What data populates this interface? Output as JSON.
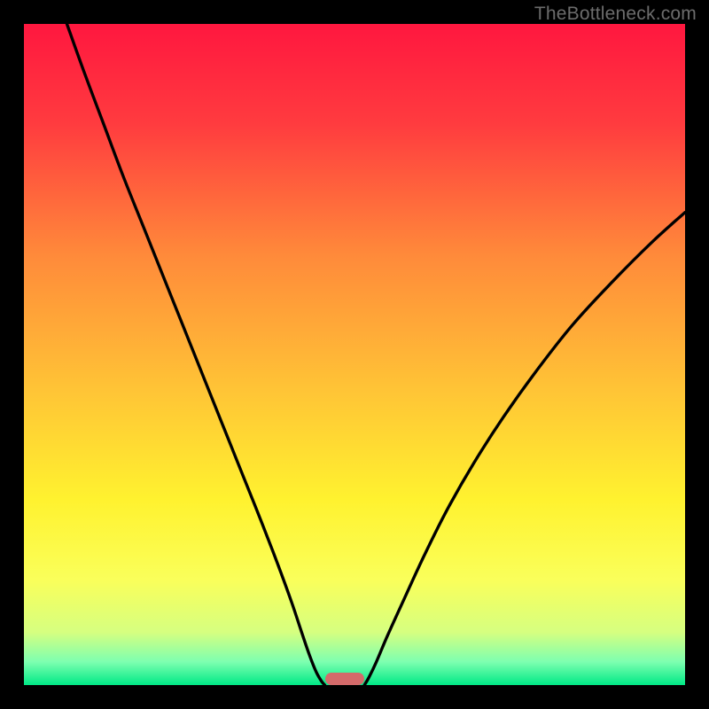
{
  "watermark": {
    "text": "TheBottleneck.com"
  },
  "chart_data": {
    "type": "line",
    "title": "",
    "xlabel": "",
    "ylabel": "",
    "xlim": [
      0,
      100
    ],
    "ylim": [
      0,
      100
    ],
    "grid": false,
    "legend": false,
    "background_gradient": {
      "stops": [
        {
          "pos": 0.0,
          "color": "#ff173f"
        },
        {
          "pos": 0.15,
          "color": "#ff3b3f"
        },
        {
          "pos": 0.35,
          "color": "#ff8a3a"
        },
        {
          "pos": 0.55,
          "color": "#ffc336"
        },
        {
          "pos": 0.72,
          "color": "#fff22f"
        },
        {
          "pos": 0.84,
          "color": "#faff5a"
        },
        {
          "pos": 0.92,
          "color": "#d6ff80"
        },
        {
          "pos": 0.965,
          "color": "#7dffb0"
        },
        {
          "pos": 1.0,
          "color": "#00e986"
        }
      ]
    },
    "series": [
      {
        "name": "left-curve",
        "x": [
          6.5,
          9,
          12,
          15,
          18,
          21,
          24,
          27,
          30,
          33,
          36,
          38.5,
          40.5,
          42,
          43.2,
          44.2,
          45,
          45.5
        ],
        "y": [
          100,
          93,
          85,
          77,
          69.5,
          62,
          54.5,
          47,
          39.5,
          32,
          24.5,
          18,
          12.5,
          8,
          4.5,
          2,
          0.6,
          0
        ]
      },
      {
        "name": "right-curve",
        "x": [
          51.5,
          52.2,
          53.3,
          55,
          57.5,
          60.5,
          64,
          68,
          72.5,
          77.5,
          83,
          89,
          95,
          100
        ],
        "y": [
          0,
          1.2,
          3.5,
          7.5,
          13,
          19.5,
          26.5,
          33.5,
          40.5,
          47.5,
          54.5,
          61,
          67,
          71.5
        ]
      }
    ],
    "marker": {
      "x": 48.5,
      "y": 0.9,
      "color": "#d46a6a"
    }
  }
}
